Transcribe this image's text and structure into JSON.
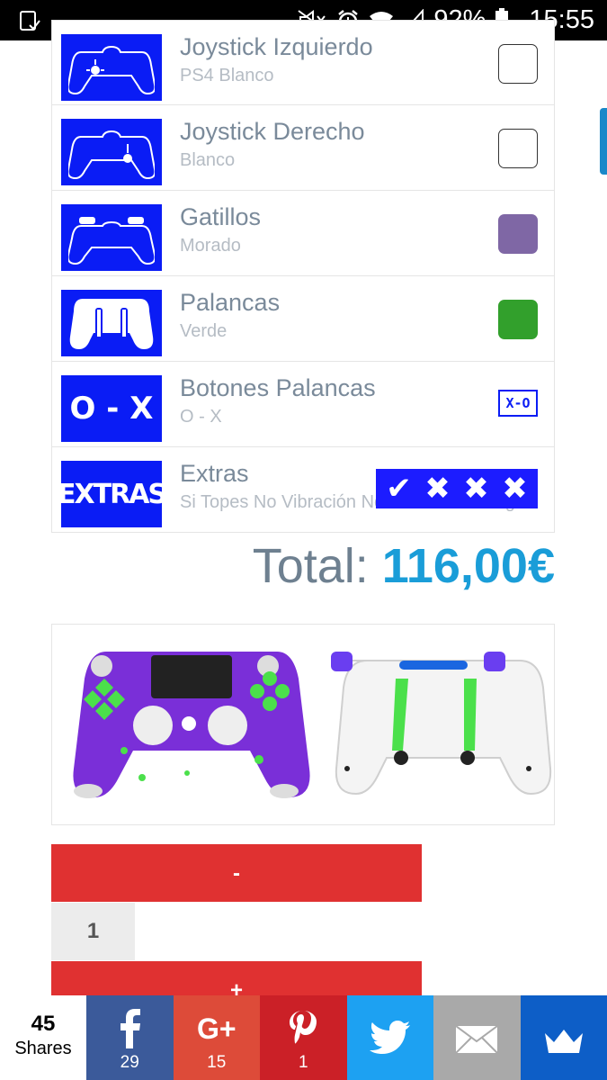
{
  "status_bar": {
    "battery": "92%",
    "time": "15:55",
    "icons": [
      "notification-icon",
      "mute-icon",
      "alarm-icon",
      "wifi-icon",
      "signal-icon",
      "battery-icon"
    ]
  },
  "options": [
    {
      "title": "Joystick Izquierdo",
      "subtitle": "PS4 Blanco",
      "swatch": "#ffffff",
      "thumb_icon": "controller-left-stick-icon"
    },
    {
      "title": "Joystick Derecho",
      "subtitle": "Blanco",
      "swatch": "#ffffff",
      "thumb_icon": "controller-right-stick-icon"
    },
    {
      "title": "Gatillos",
      "subtitle": "Morado",
      "swatch": "#7f67a5",
      "thumb_icon": "controller-triggers-icon"
    },
    {
      "title": "Palancas",
      "subtitle": "Verde",
      "swatch": "#32a02c",
      "thumb_icon": "controller-paddles-icon"
    },
    {
      "title": "Botones Palancas",
      "subtitle": "O - X",
      "thumb_text": "O - X",
      "swatch_text": "X-O"
    },
    {
      "title": "Extras",
      "subtitle": "Si Topes No Vibración No Iluminación Logo",
      "thumb_text": "EXTRAS",
      "checks": [
        "✔",
        "✖",
        "✖",
        "✖"
      ]
    }
  ],
  "total": {
    "label": "Total:",
    "amount": "116,00€"
  },
  "quantity": {
    "minus": "-",
    "value": "1",
    "plus": "+"
  },
  "share": {
    "count": "45",
    "count_label": "Shares",
    "buttons": [
      {
        "name": "facebook",
        "icon": "facebook-icon",
        "count": "29"
      },
      {
        "name": "google-plus",
        "icon": "google-plus-icon",
        "count": "15"
      },
      {
        "name": "pinterest",
        "icon": "pinterest-icon",
        "count": "1"
      },
      {
        "name": "twitter",
        "icon": "twitter-icon",
        "count": ""
      },
      {
        "name": "email",
        "icon": "email-icon",
        "count": ""
      },
      {
        "name": "sumo",
        "icon": "crown-icon",
        "count": ""
      }
    ]
  },
  "colors": {
    "thumb_blue": "#0a1cf5",
    "accent_blue": "#1a9dd8",
    "button_red": "#e03131",
    "text_grey": "#7a8a9a"
  }
}
